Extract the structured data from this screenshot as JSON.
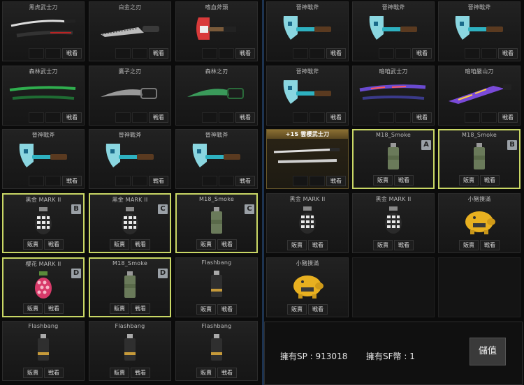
{
  "left_items": [
    {
      "name": "黑虎武士刀",
      "type": "katana",
      "buttons": [
        "戦看"
      ]
    },
    {
      "name": "白金之刃",
      "type": "knife",
      "buttons": [
        "戦看"
      ]
    },
    {
      "name": "嗜血斧頭",
      "type": "axe-red",
      "buttons": [
        "戦看"
      ]
    },
    {
      "name": "森林武士刀",
      "type": "katana-green",
      "buttons": [
        "戦看"
      ]
    },
    {
      "name": "鷹子之刃",
      "type": "claw",
      "buttons": [
        "戦看"
      ]
    },
    {
      "name": "森林之刃",
      "type": "claw-green",
      "buttons": [
        "戦看"
      ]
    },
    {
      "name": "晉神戰斧",
      "type": "axe-blue",
      "buttons": [
        "戦看"
      ]
    },
    {
      "name": "晉神戰斧",
      "type": "axe-blue",
      "buttons": [
        "戦看"
      ]
    },
    {
      "name": "晉神戰斧",
      "type": "axe-blue",
      "buttons": [
        "戦看"
      ]
    },
    {
      "name": "黑金 MARK II",
      "type": "grenade-black",
      "buttons": [
        "販賣",
        "戦看"
      ],
      "badge": "B",
      "selected": true
    },
    {
      "name": "黑金 MARK II",
      "type": "grenade-black",
      "buttons": [
        "販賣",
        "戦看"
      ],
      "badge": "C",
      "selected": true
    },
    {
      "name": "M18_Smoke",
      "type": "smoke",
      "buttons": [
        "販賣",
        "戦看"
      ],
      "badge": "C",
      "selected": true
    },
    {
      "name": "櫻花 MARK II",
      "type": "grenade-pink",
      "buttons": [
        "販賣",
        "戦看"
      ],
      "badge": "D",
      "selected": true
    },
    {
      "name": "M18_Smoke",
      "type": "smoke",
      "buttons": [
        "販賣",
        "戦看"
      ],
      "badge": "D",
      "selected": true
    },
    {
      "name": "Flashbang",
      "type": "flash",
      "buttons": [
        "販賣",
        "戦看"
      ]
    },
    {
      "name": "Flashbang",
      "type": "flash",
      "buttons": [
        "販賣",
        "戦看"
      ]
    },
    {
      "name": "Flashbang",
      "type": "flash",
      "buttons": [
        "販賣",
        "戦看"
      ]
    },
    {
      "name": "Flashbang",
      "type": "flash",
      "buttons": [
        "販賣",
        "戦看"
      ]
    }
  ],
  "right_items": [
    {
      "name": "晉神戰斧",
      "type": "axe-blue",
      "buttons": [
        "戦看"
      ]
    },
    {
      "name": "晉神戰斧",
      "type": "axe-blue",
      "buttons": [
        "戦看"
      ]
    },
    {
      "name": "晉神戰斧",
      "type": "axe-blue",
      "buttons": [
        "戦看"
      ]
    },
    {
      "name": "晉神戰斧",
      "type": "axe-blue",
      "buttons": [
        "戦看"
      ]
    },
    {
      "name": "暗咱武士刀",
      "type": "katana-graffiti",
      "buttons": [
        "戦看"
      ]
    },
    {
      "name": "暗咱嚴山刀",
      "type": "machete-graffiti",
      "buttons": [
        "戦看"
      ]
    },
    {
      "name": "+1S 雲櫻武士刀",
      "type": "katana-silver",
      "buttons": [
        "戦看"
      ],
      "gold": true
    },
    {
      "name": "M18_Smoke",
      "type": "smoke",
      "buttons": [
        "販賣",
        "戦看"
      ],
      "badge": "A",
      "selected": true
    },
    {
      "name": "M18_Smoke",
      "type": "smoke",
      "buttons": [
        "販賣",
        "戦看"
      ],
      "badge": "B",
      "selected": true
    },
    {
      "name": "黑金 MARK II",
      "type": "grenade-black",
      "buttons": [
        "販賣",
        "戦看"
      ]
    },
    {
      "name": "黑金 MARK II",
      "type": "grenade-black",
      "buttons": [
        "販賣",
        "戦看"
      ]
    },
    {
      "name": "小豬撲滿",
      "type": "piggy",
      "buttons": [
        "販賣",
        "戦看"
      ]
    },
    {
      "name": "小豬撲滿",
      "type": "piggy",
      "buttons": [
        "販賣",
        "戦看"
      ]
    }
  ],
  "wallet": {
    "sp_label": "擁有SP : 913018",
    "sf_label": "擁有SF幣 : 1",
    "save_label": "儲值"
  },
  "colors": {
    "selected_border": "#c9d765",
    "badge_bg": "#9aa0a6",
    "panel_bg": "#0b0b0b"
  }
}
